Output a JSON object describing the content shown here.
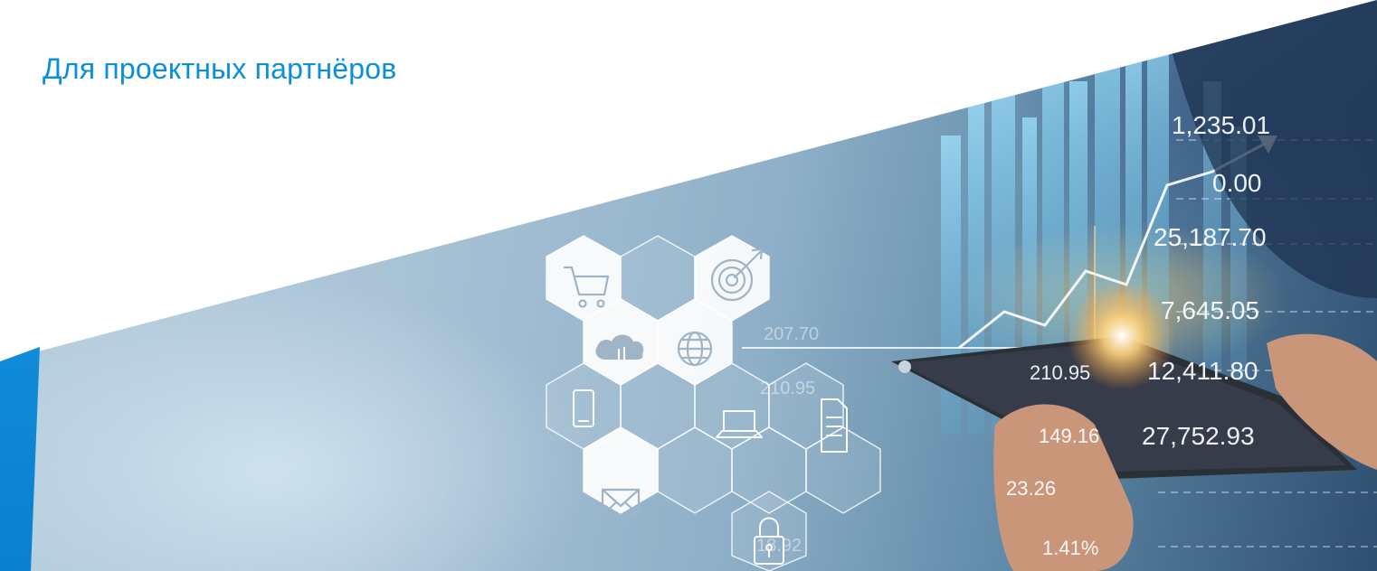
{
  "banner": {
    "title": "Для проектных партнёров"
  },
  "colors": {
    "accent": "#0b8fd8",
    "bar": "#1aa0e6"
  },
  "dashboard_numbers": {
    "n1": "1,235.01",
    "n2": "0.00",
    "n3": "25,187.70",
    "n4": "7,645.05",
    "n5": "12,411.80",
    "n6": "27,752.93",
    "n7": "210.95",
    "n8": "149.16",
    "n9": "23.26",
    "n10": "1.41%",
    "n11": "207.70",
    "n12": "210.95",
    "n13": "18.92"
  },
  "icons": [
    "shopping-cart-icon",
    "target-icon",
    "cloud-icon",
    "globe-icon",
    "smartphone-icon",
    "laptop-icon",
    "document-icon",
    "envelope-icon",
    "lock-icon"
  ]
}
